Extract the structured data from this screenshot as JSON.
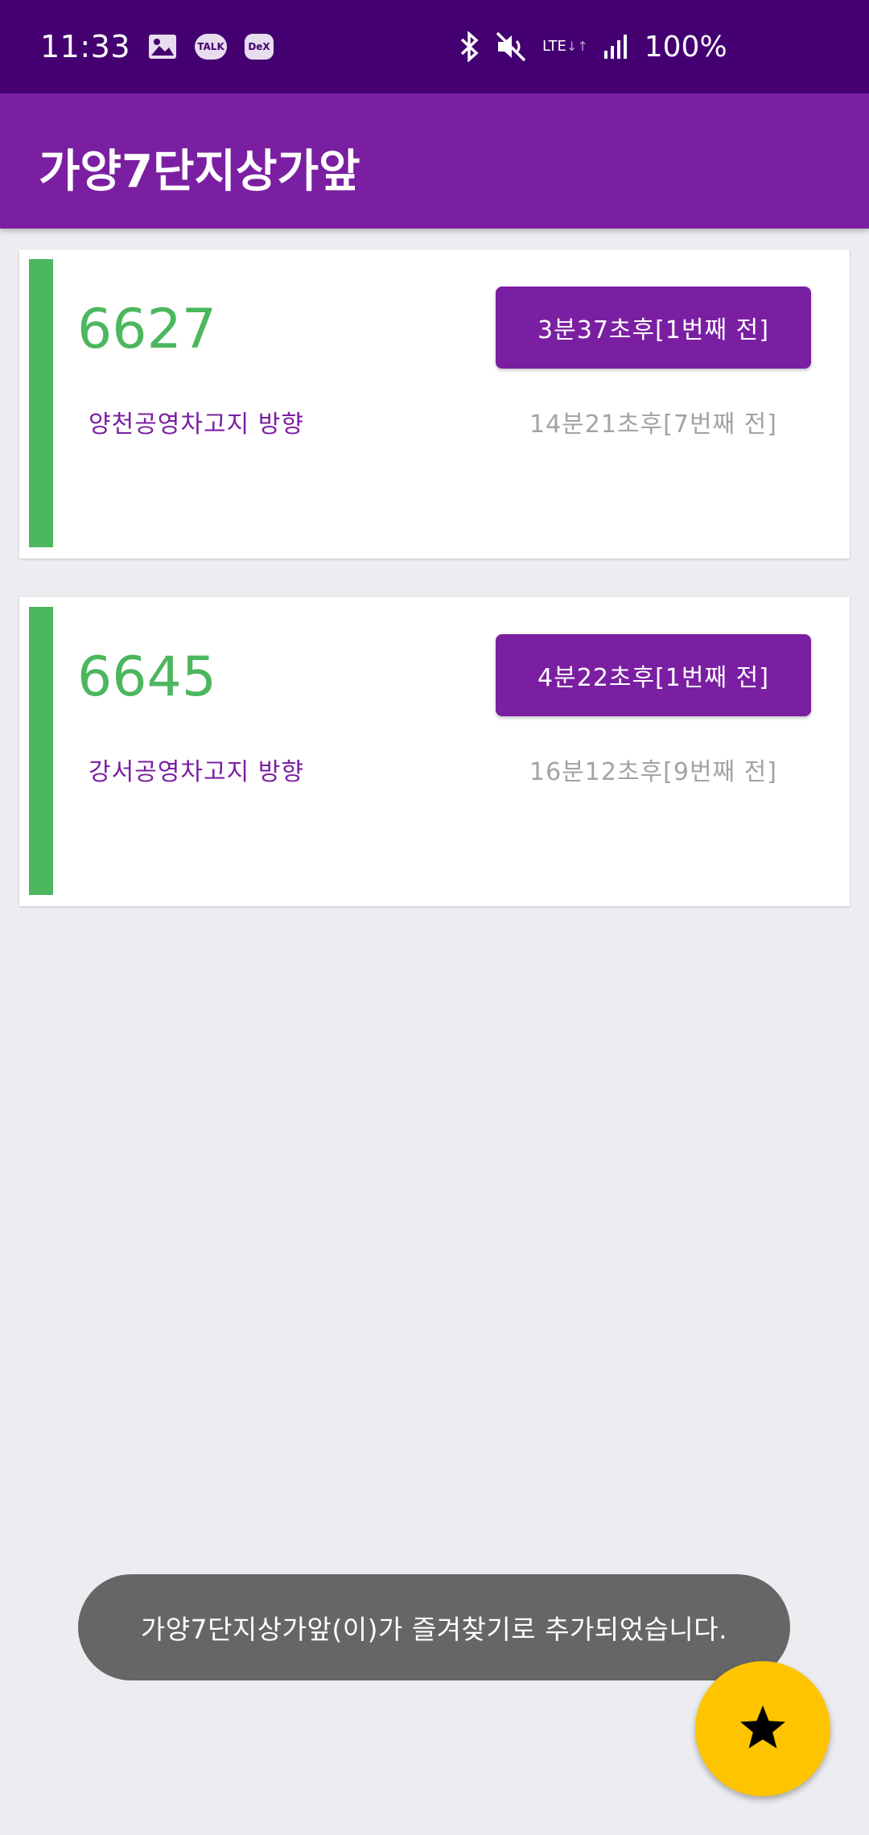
{
  "status_bar": {
    "time": "11:33",
    "notification_icons": [
      "gallery-icon",
      "kakaotalk-icon",
      "dex-icon"
    ],
    "talk_label": "TALK",
    "dex_label": "DeX",
    "system_icons": [
      "bluetooth-icon",
      "mute-icon",
      "lte-icon",
      "signal-icon"
    ],
    "network_label": "LTE",
    "battery": "100%"
  },
  "app_bar": {
    "title": "가양7단지상가앞"
  },
  "arrivals": [
    {
      "route": "6627",
      "direction": "양천공영차고지 방향",
      "first_arrival": "3분37초후[1번째 전]",
      "second_arrival": "14분21초후[7번째 전]"
    },
    {
      "route": "6645",
      "direction": "강서공영차고지 방향",
      "first_arrival": "4분22초후[1번째 전]",
      "second_arrival": "16분12초후[9번째 전]"
    }
  ],
  "toast": {
    "message": "가양7단지상가앞(이)가 즐겨찾기로 추가되었습니다."
  },
  "fab": {
    "icon": "star-icon"
  },
  "colors": {
    "status_bar": "#440071",
    "primary": "#7B1FA2",
    "accent_green": "#4CB75E",
    "fab": "#FFC400",
    "background": "#ECEDF1",
    "toast": "#666666"
  }
}
